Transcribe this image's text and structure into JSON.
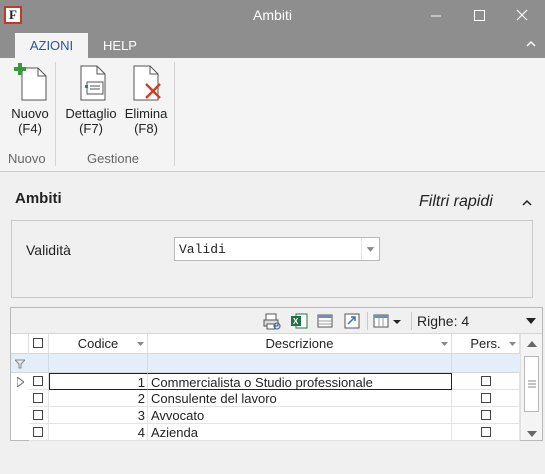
{
  "window": {
    "title": "Ambiti",
    "app_letter": "F"
  },
  "ribbon": {
    "tabs": [
      "AZIONI",
      "HELP"
    ],
    "buttons": {
      "nuovo": {
        "label": "Nuovo",
        "shortcut": "(F4)"
      },
      "dettaglio": {
        "label": "Dettaglio",
        "shortcut": "(F7)"
      },
      "elimina": {
        "label": "Elimina",
        "shortcut": "(F8)"
      }
    },
    "groups": [
      "Nuovo",
      "Gestione"
    ]
  },
  "section": {
    "title": "Ambiti",
    "quick_filters": "Filtri rapidi"
  },
  "filters": {
    "validity_label": "Validità",
    "validity_value": "Validi"
  },
  "grid": {
    "rows_label": "Righe: 4",
    "columns": [
      "Codice",
      "Descrizione",
      "Pers."
    ],
    "rows": [
      {
        "code": "1",
        "description": "Commercialista o Studio professionale"
      },
      {
        "code": "2",
        "description": "Consulente del lavoro"
      },
      {
        "code": "3",
        "description": "Avvocato"
      },
      {
        "code": "4",
        "description": "Azienda"
      }
    ]
  },
  "colors": {
    "titlebar": "#8e8e8e",
    "accent": "#2b5797",
    "filter_row": "#e4eef8"
  }
}
